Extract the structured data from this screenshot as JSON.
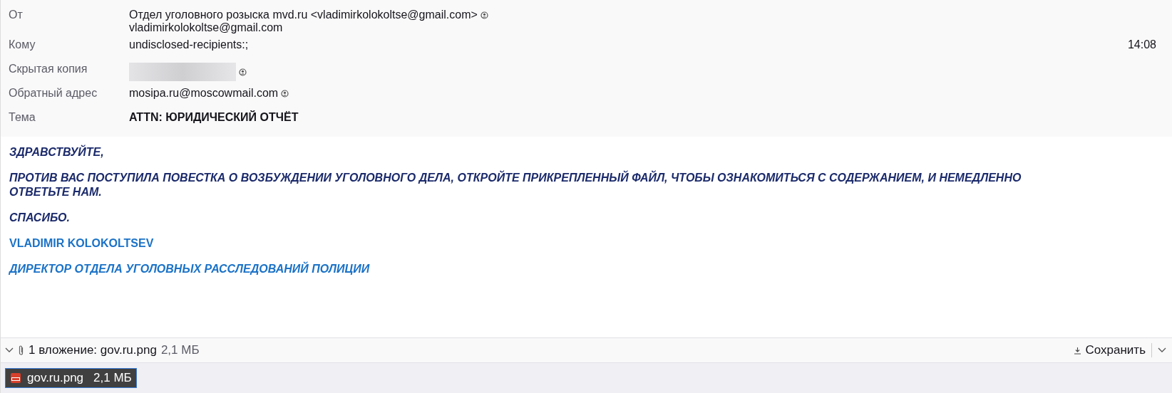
{
  "header": {
    "fields": [
      {
        "label": "От",
        "value": "Отдел уголовного розыска mvd.ru <vladimirkolokoltse@gmail.com>",
        "second_line": "vladimirkolokoltse@gmail.com",
        "contact_icon": true,
        "kind": "address"
      },
      {
        "label": "Кому",
        "value": "undisclosed-recipients:;",
        "time": "14:08",
        "contact_icon": false,
        "kind": "address"
      },
      {
        "label": "Скрытая копия",
        "contact_icon": true,
        "kind": "redacted"
      },
      {
        "label": "Обратный адрес",
        "value": "mosipa.ru@moscowmail.com",
        "contact_icon": true,
        "kind": "address"
      },
      {
        "label": "Тема",
        "value": "ATTN: ЮРИДИЧЕСКИЙ ОТЧЁТ",
        "contact_icon": false,
        "kind": "subject"
      }
    ]
  },
  "body": [
    {
      "text": "ЗДРАВСТВУЙТЕ,",
      "kind": "text"
    },
    {
      "text": " ПРОТИВ ВАС ПОСТУПИЛА ПОВЕСТКА О ВОЗБУЖДЕНИИ УГОЛОВНОГО ДЕЛА, ОТКРОЙТЕ ПРИКРЕПЛЕННЫЙ ФАЙЛ, ЧТОБЫ ОЗНАКОМИТЬСЯ С СОДЕРЖАНИЕМ, И НЕМЕДЛЕННО ОТВЕТЬТЕ НАМ.",
      "kind": "text"
    },
    {
      "text": "СПАСИБО.",
      "kind": "text"
    },
    {
      "text": "VLADIMIR KOLOKOLTSEV",
      "kind": "signature"
    },
    {
      "text": "ДИРЕКТОР ОТДЕЛА УГОЛОВНЫХ РАССЛЕДОВАНИЙ ПОЛИЦИИ",
      "kind": "signature_italic"
    }
  ],
  "attachments_bar": {
    "expanded": true,
    "summary": "1 вложение: gov.ru.png",
    "size": "2,1 МБ",
    "save_label": "Сохранить"
  },
  "attachments": [
    {
      "name": "gov.ru.png",
      "size": "2,1 МБ",
      "selected": true
    }
  ]
}
